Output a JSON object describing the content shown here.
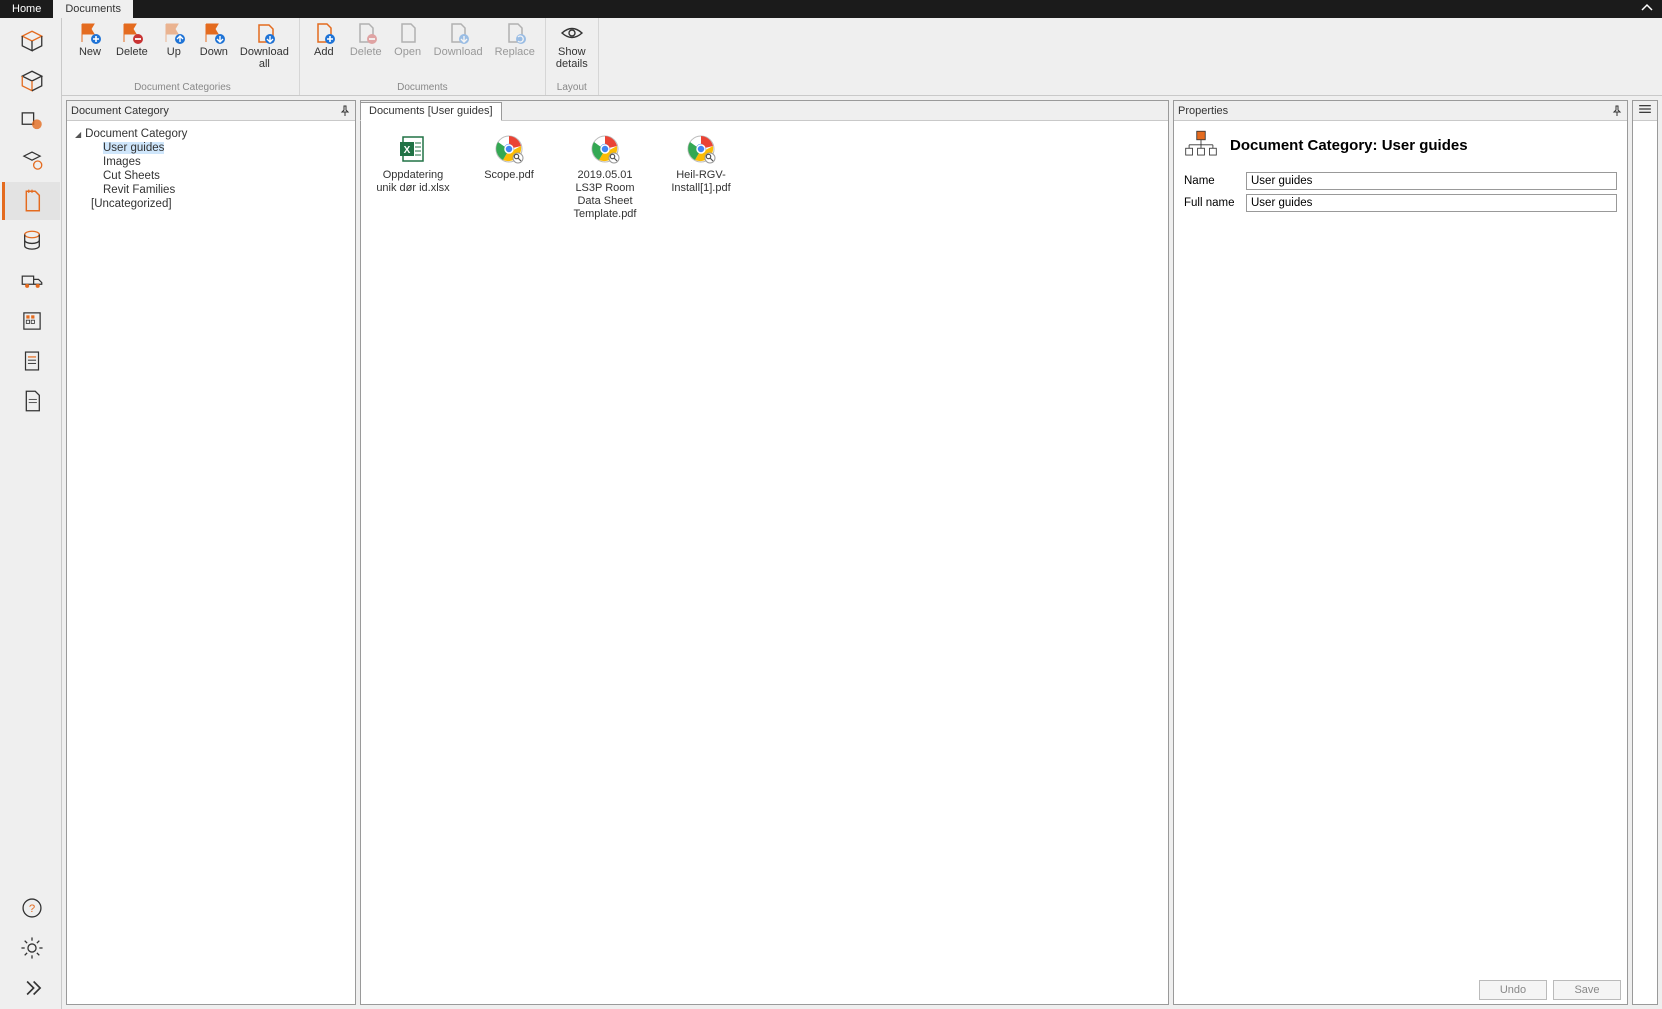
{
  "tabs": {
    "home": "Home",
    "documents": "Documents"
  },
  "leftnav": {
    "items": [
      {
        "name": "nav-cube-1"
      },
      {
        "name": "nav-cube-2"
      },
      {
        "name": "nav-products"
      },
      {
        "name": "nav-components"
      },
      {
        "name": "nav-documents",
        "active": true
      },
      {
        "name": "nav-database"
      },
      {
        "name": "nav-truck"
      },
      {
        "name": "nav-building"
      },
      {
        "name": "nav-report"
      },
      {
        "name": "nav-sheet"
      }
    ],
    "help": "nav-help",
    "settings": "nav-settings",
    "expand": "nav-expand"
  },
  "ribbon": {
    "groups": [
      {
        "caption": "Document Categories",
        "buttons": [
          {
            "key": "new",
            "label": "New"
          },
          {
            "key": "delete_cat",
            "label": "Delete"
          },
          {
            "key": "up",
            "label": "Up"
          },
          {
            "key": "down",
            "label": "Down"
          },
          {
            "key": "download_all",
            "label": "Download\nall"
          }
        ]
      },
      {
        "caption": "Documents",
        "buttons": [
          {
            "key": "add",
            "label": "Add"
          },
          {
            "key": "delete_doc",
            "label": "Delete",
            "disabled": true
          },
          {
            "key": "open",
            "label": "Open",
            "disabled": true
          },
          {
            "key": "download",
            "label": "Download",
            "disabled": true
          },
          {
            "key": "replace",
            "label": "Replace",
            "disabled": true
          }
        ]
      },
      {
        "caption": "Layout",
        "buttons": [
          {
            "key": "show_details",
            "label": "Show\ndetails"
          }
        ]
      }
    ]
  },
  "panels": {
    "tree_title": "Document Category",
    "docs_title": "Documents [User guides]",
    "props_title": "Properties"
  },
  "tree": {
    "root": "Document Category",
    "children": [
      {
        "label": "User guides",
        "selected": true
      },
      {
        "label": "Images"
      },
      {
        "label": "Cut Sheets"
      },
      {
        "label": "Revit Families"
      }
    ],
    "uncategorized": "[Uncategorized]"
  },
  "documents": [
    {
      "name": "Oppdatering unik dør id.xlsx",
      "icon": "excel"
    },
    {
      "name": "Scope.pdf",
      "icon": "chrome"
    },
    {
      "name": "2019.05.01 LS3P Room Data Sheet Template.pdf",
      "icon": "chrome"
    },
    {
      "name": "Heil-RGV-Install[1].pdf",
      "icon": "chrome"
    }
  ],
  "properties": {
    "heading_prefix": "Document Category: ",
    "heading_value": "User guides",
    "name_label": "Name",
    "name_value": "User guides",
    "fullname_label": "Full name",
    "fullname_value": "User guides",
    "undo": "Undo",
    "save": "Save"
  }
}
